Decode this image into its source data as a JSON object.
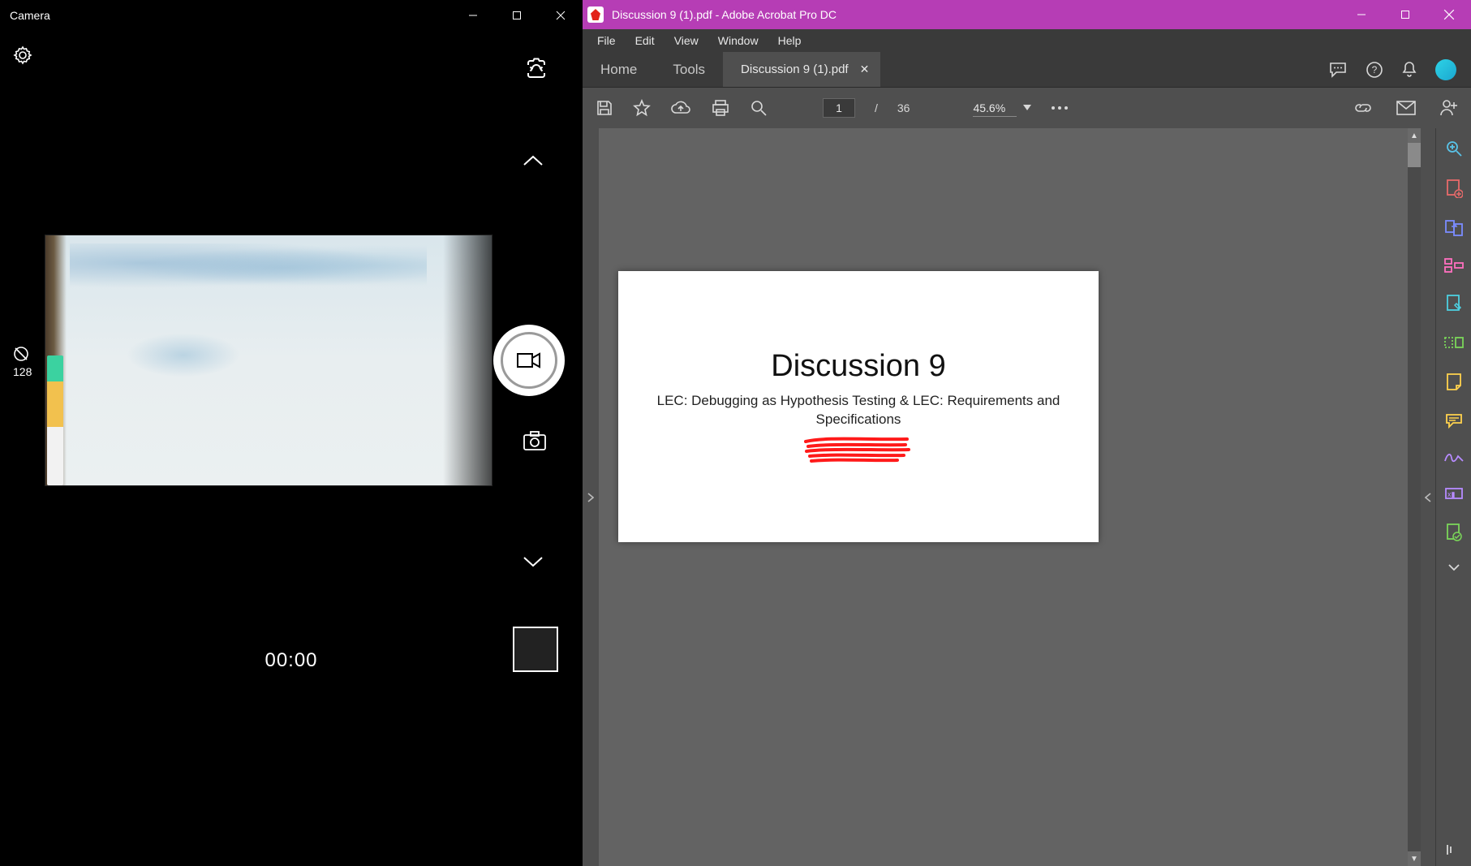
{
  "camera": {
    "title": "Camera",
    "iso_value": "128",
    "timer": "00:00"
  },
  "acrobat": {
    "title_doc": "Discussion 9 (1).pdf",
    "title_app": "Adobe Acrobat Pro DC",
    "menu": {
      "file": "File",
      "edit": "Edit",
      "view": "View",
      "window": "Window",
      "help": "Help"
    },
    "tabs": {
      "home": "Home",
      "tools": "Tools",
      "doc": "Discussion 9 (1).pdf"
    },
    "page_current": "1",
    "page_sep": "/",
    "page_total": "36",
    "zoom": "45.6%",
    "document": {
      "heading": "Discussion 9",
      "subtitle": "LEC: Debugging as Hypothesis Testing & LEC: Requirements and Specifications"
    }
  }
}
